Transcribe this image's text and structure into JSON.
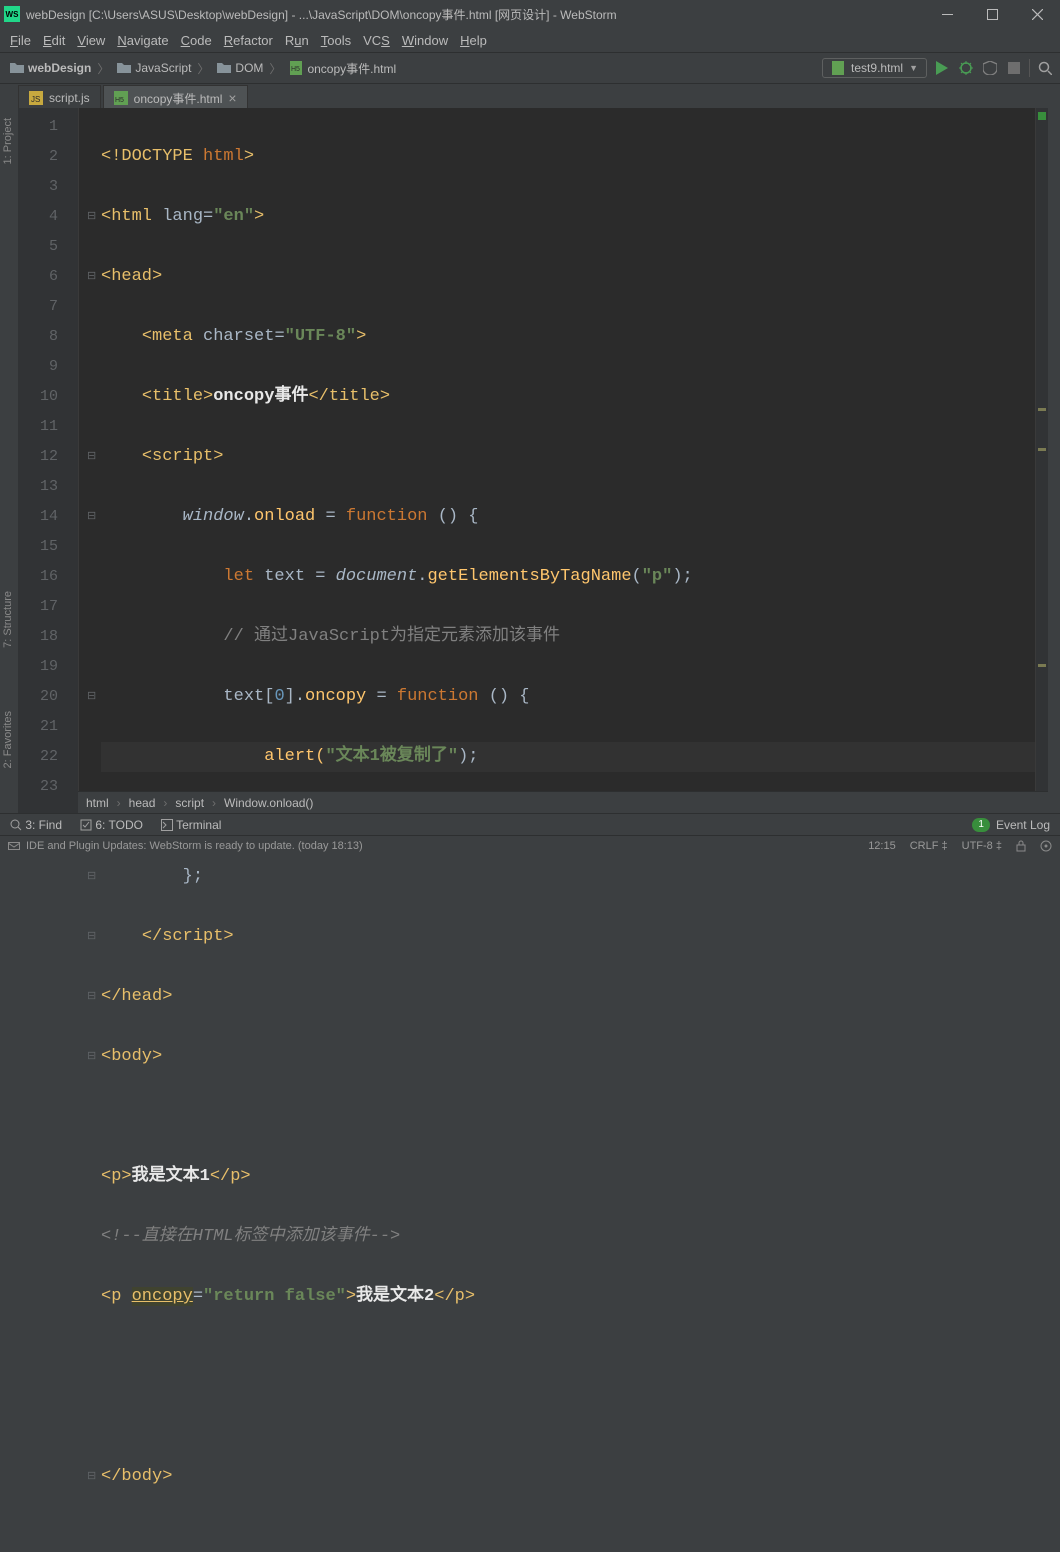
{
  "titlebar": {
    "icon_text": "WS",
    "title": "webDesign [C:\\Users\\ASUS\\Desktop\\webDesign] - ...\\JavaScript\\DOM\\oncopy事件.html [网页设计] - WebStorm"
  },
  "menu": [
    "File",
    "Edit",
    "View",
    "Navigate",
    "Code",
    "Refactor",
    "Run",
    "Tools",
    "VCS",
    "Window",
    "Help"
  ],
  "breadcrumbs": [
    {
      "icon": "folder",
      "label": "webDesign"
    },
    {
      "icon": "folder",
      "label": "JavaScript"
    },
    {
      "icon": "folder",
      "label": "DOM"
    },
    {
      "icon": "html",
      "label": "oncopy事件.html"
    }
  ],
  "run_config": {
    "icon": "html",
    "label": "test9.html"
  },
  "tabs": [
    {
      "icon": "js",
      "label": "script.js",
      "active": false,
      "closable": false
    },
    {
      "icon": "html",
      "label": "oncopy事件.html",
      "active": true,
      "closable": true
    }
  ],
  "side_panels": {
    "project": "1: Project",
    "structure": "7: Structure",
    "favorites": "2: Favorites"
  },
  "gutter_lines": 23,
  "code_crumb": [
    "html",
    "head",
    "script",
    "Window.onload()"
  ],
  "bottom_tools": {
    "find": "3: Find",
    "todo": "6: TODO",
    "terminal": "Terminal",
    "event_log": "Event Log",
    "event_badge": "1"
  },
  "status": {
    "msg": "IDE and Plugin Updates: WebStorm is ready to update. (today 18:13)",
    "pos": "12:15",
    "sep": "CRLF",
    "enc": "UTF-8"
  },
  "code": {
    "l1": {
      "a": "<!DOCTYPE ",
      "b": "html",
      "c": ">"
    },
    "l2": {
      "a": "<html ",
      "b": "lang=",
      "c": "\"en\"",
      "d": ">"
    },
    "l3": {
      "a": "<head>"
    },
    "l4": {
      "a": "<meta ",
      "b": "charset=",
      "c": "\"UTF-8\"",
      "d": ">"
    },
    "l5": {
      "a": "<title>",
      "b": "oncopy事件",
      "c": "</title>"
    },
    "l6": {
      "a": "<script>"
    },
    "l7": {
      "a": "window",
      "b": ".",
      "c": "onload ",
      "d": "= ",
      "e": "function ",
      "f": "() {"
    },
    "l8": {
      "a": "let ",
      "b": "text ",
      "c": "= ",
      "d": "document",
      "e": ".",
      "f": "getElementsByTagName",
      "g": "(",
      "h": "\"p\"",
      "i": ");"
    },
    "l9": {
      "a": "// 通过JavaScript为指定元素添加该事件"
    },
    "l10": {
      "a": "text[",
      "b": "0",
      "c": "].",
      "d": "oncopy ",
      "e": "= ",
      "f": "function ",
      "g": "() {"
    },
    "l11": {
      "a": "alert(",
      "b": "\"文本1被复制了\"",
      "c": ");"
    },
    "l12": {
      "a": "};"
    },
    "l13": {
      "a": "};"
    },
    "l14": {
      "a": "</script>"
    },
    "l15": {
      "a": "</head>"
    },
    "l16": {
      "a": "<body>"
    },
    "l18": {
      "a": "<p>",
      "b": "我是文本1",
      "c": "</p>"
    },
    "l19": {
      "a": "<!--直接在HTML标签中添加该事件-->"
    },
    "l20": {
      "a": "<p ",
      "b": "oncopy",
      "c": "=",
      "d": "\"return false\"",
      "e": ">",
      "f": "我是文本2",
      "g": "</p>"
    },
    "l23": {
      "a": "</body>"
    }
  }
}
